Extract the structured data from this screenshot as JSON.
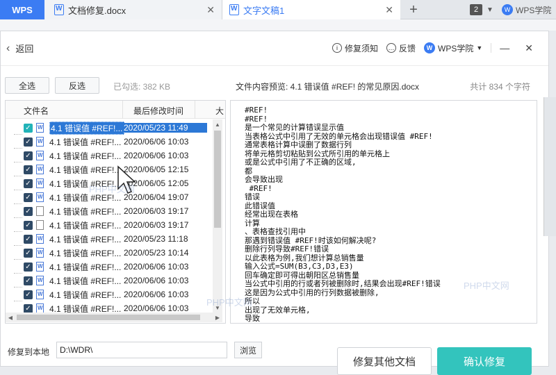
{
  "tabs": {
    "wps": "WPS",
    "doc1": "文档修复.docx",
    "doc2": "文字文稿1",
    "add": "+",
    "count": "2",
    "academy": "WPS学院"
  },
  "header": {
    "back": "返回",
    "repair_notice": "修复须知",
    "feedback": "反馈",
    "academy": "WPS学院"
  },
  "toolbar": {
    "select_all": "全选",
    "invert": "反选",
    "checked_size": "已勾选: 382 KB"
  },
  "file_list": {
    "col_name": "文件名",
    "col_date": "最后修改时间",
    "col_size": "大",
    "rows": [
      {
        "name": "4.1 错误值 #REF!...",
        "date": "2020/05/23 11:49"
      },
      {
        "name": "4.1 错误值 #REF!...",
        "date": "2020/06/06 10:03"
      },
      {
        "name": "4.1 错误值 #REF!...",
        "date": "2020/06/06 10:03"
      },
      {
        "name": "4.1 错误值 #REF!...",
        "date": "2020/06/05 12:15"
      },
      {
        "name": "4.1 错误值 #REF!...",
        "date": "2020/06/05 12:05"
      },
      {
        "name": "4.1 错误值 #REF!...",
        "date": "2020/06/04 19:07"
      },
      {
        "name": "4.1 错误值 #REF!...",
        "date": "2020/06/03 19:17"
      },
      {
        "name": "4.1 错误值 #REF!...",
        "date": "2020/06/03 19:17"
      },
      {
        "name": "4.1 错误值 #REF!...",
        "date": "2020/05/23 11:18"
      },
      {
        "name": "4.1 错误值 #REF!...",
        "date": "2020/05/23 10:14"
      },
      {
        "name": "4.1 错误值 #REF!...",
        "date": "2020/06/06 10:03"
      },
      {
        "name": "4.1 错误值 #REF!...",
        "date": "2020/06/06 10:03"
      },
      {
        "name": "4.1 错误值 #REF!...",
        "date": "2020/06/06 10:03"
      },
      {
        "name": "4.1 错误值 #REF!...",
        "date": "2020/06/06 10:03"
      }
    ]
  },
  "preview": {
    "title": "文件内容预览: 4.1 错误值 #REF! 的常见原因.docx",
    "total": "共计 834 个字符",
    "lines": [
      "#REF!",
      "#REF!",
      "是一个常见的计算错误显示值",
      "当表格公式中引用了无效的单元格会出现错误值 #REF!",
      "通常表格计算中误删了数据行列",
      "将单元格剪切粘贴到公式所引用的单元格上",
      "或是公式中引用了不正确的区域,",
      "都",
      "会导致出现",
      " #REF!",
      "错误",
      "此错误值",
      "经常出现在表格",
      "计算",
      "、表格查找引用中",
      "那遇到错误值 #REF!时该如何解决呢?",
      "删除行列导致#REF!错误",
      "以此表格为例,我们想计算总销售量",
      "输入公式=SUM(B3,C3,D3,E3)",
      "回车确定即可得出朝阳区总销售量",
      "当公式中引用的行或者列被删除时,结果会出现#REF!错误",
      "这是因为公式中引用的行列数据被删除,",
      "所以",
      "出现了无效单元格,",
      "导致"
    ]
  },
  "footer": {
    "save_label": "修复到本地",
    "path": "D:\\WDR\\",
    "browse": "浏览",
    "repair_other": "修复其他文档",
    "confirm": "确认修复"
  },
  "watermarks": [
    "PHP中文网",
    "PHP中文网",
    "PHP中文网"
  ]
}
